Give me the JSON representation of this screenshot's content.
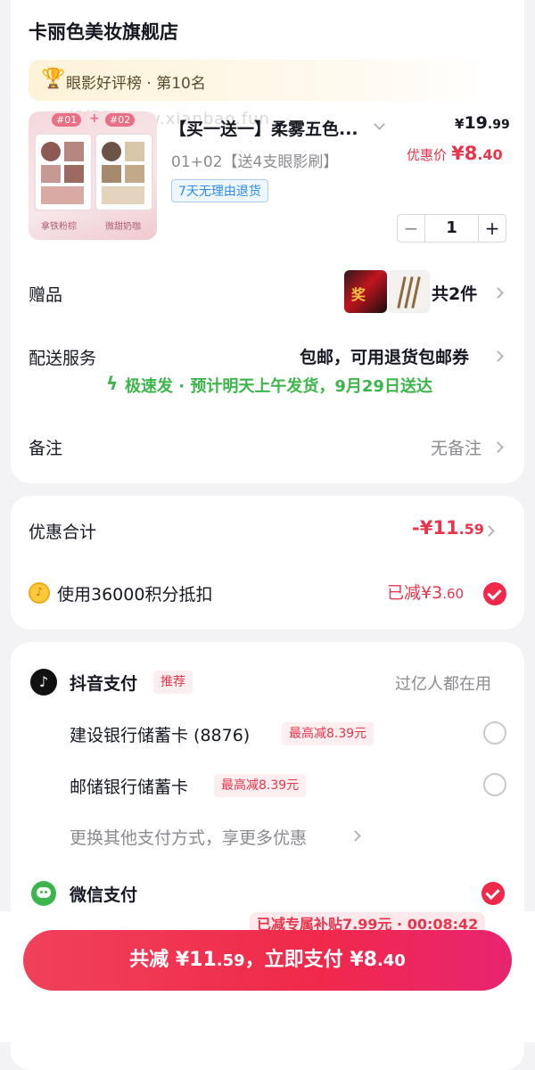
{
  "shop": {
    "name": "卡丽色美妆旗舰店",
    "rank_text": "眼影好评榜 · 第10名",
    "watermark": "线报酷-new.xianbao.fun"
  },
  "product": {
    "title": "【买一送一】柔雾五色...",
    "spec": "01+02【送4支眼影刷】",
    "return_tag": "7天无理由退货",
    "price_symbol": "¥",
    "price_int": "19",
    "price_dec": ".99",
    "promo_label": "优惠价",
    "promo_price_int": "¥8",
    "promo_price_dec": ".40",
    "quantity": "1",
    "minus": "−",
    "plus": "+",
    "thumb_badge_1": "#01",
    "thumb_badge_2": "#02",
    "thumb_plus": "+",
    "thumb_caption_1": "拿铁粉棕",
    "thumb_caption_2": "微甜奶咖"
  },
  "gift": {
    "label": "赠品",
    "count": "共2件",
    "gift_img_text": "奖"
  },
  "delivery": {
    "label": "配送服务",
    "value": "包邮，可用退货包邮券",
    "speed_text": "极速发 · 预计明天上午发货，9月29日送达"
  },
  "note": {
    "label": "备注",
    "value": "无备注"
  },
  "discount": {
    "label": "优惠合计",
    "value_prefix": "-¥11",
    "value_dec": ".59",
    "points_label": "使用36000积分抵扣",
    "points_reduced_prefix": "已减¥3",
    "points_reduced_dec": ".60"
  },
  "payment": {
    "douyin_label": "抖音支付",
    "douyin_tag": "推荐",
    "douyin_hint": "过亿人都在用",
    "bank1_label": "建设银行储蓄卡 (8876)",
    "bank1_tag": "最高减8.39元",
    "bank2_label": "邮储银行储蓄卡",
    "bank2_tag": "最高减8.39元",
    "more_label": "更换其他支付方式，享更多优惠",
    "wechat_label": "微信支付"
  },
  "bottom": {
    "subsidy_text": "已减专属补贴7.99元 · 00:08:42",
    "pay_prefix": "共减 ¥11",
    "pay_mid_dec": ".59",
    "pay_mid": "，立即支付 ¥8",
    "pay_dec": ".40"
  },
  "colors": {
    "accent": "#f0294b",
    "green": "#3cb54a",
    "blue_tag": "#2e8be8"
  }
}
